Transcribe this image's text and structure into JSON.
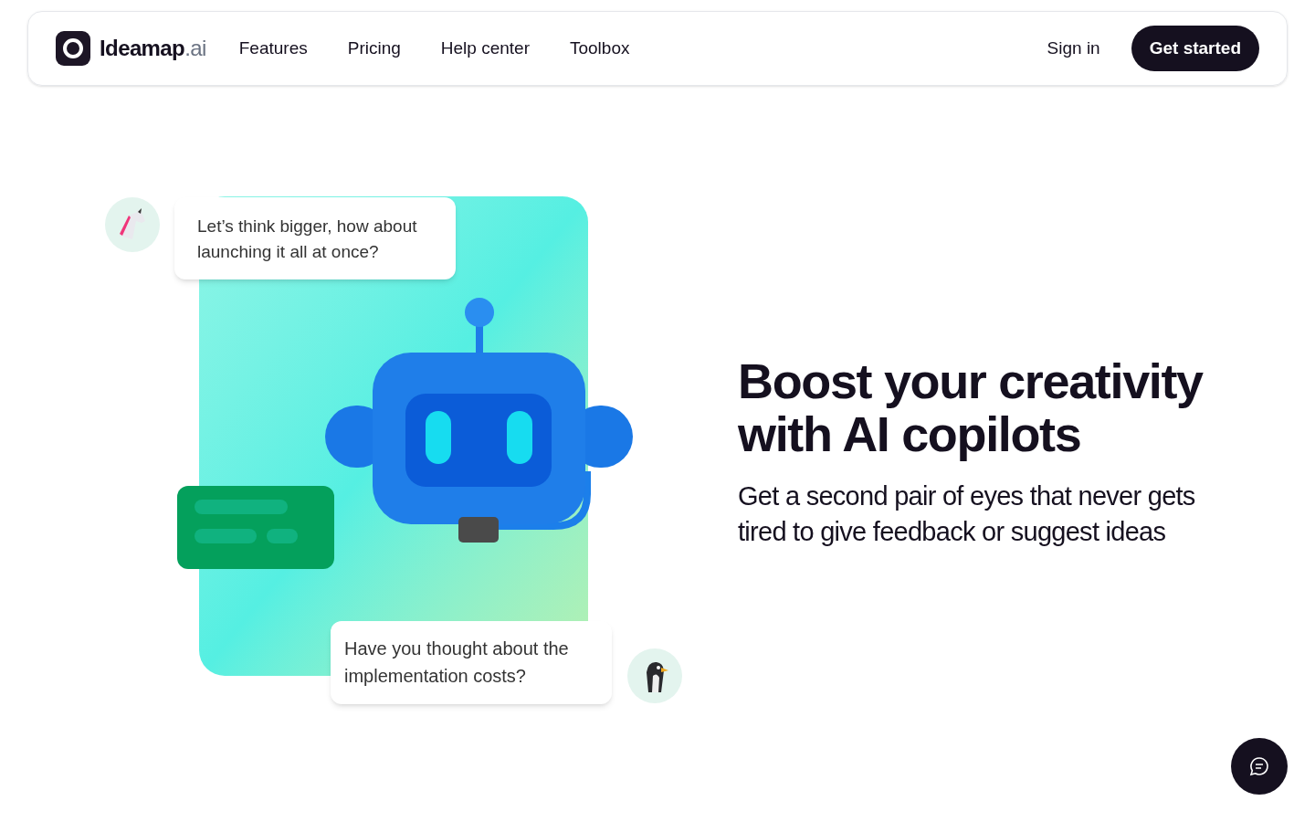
{
  "nav": {
    "brand_name": "Ideamap",
    "brand_suffix": ".ai",
    "links": [
      "Features",
      "Pricing",
      "Help center",
      "Toolbox"
    ],
    "sign_in": "Sign in",
    "cta": "Get started"
  },
  "hero": {
    "bubbles": [
      "Let’s think bigger, how about launching it all at once?",
      "Have you thought about the implementation costs?"
    ],
    "headline": "Boost your creativity with AI copilots",
    "subtitle": "Get a second pair of eyes that never gets tired to give feedback or suggest ideas"
  }
}
